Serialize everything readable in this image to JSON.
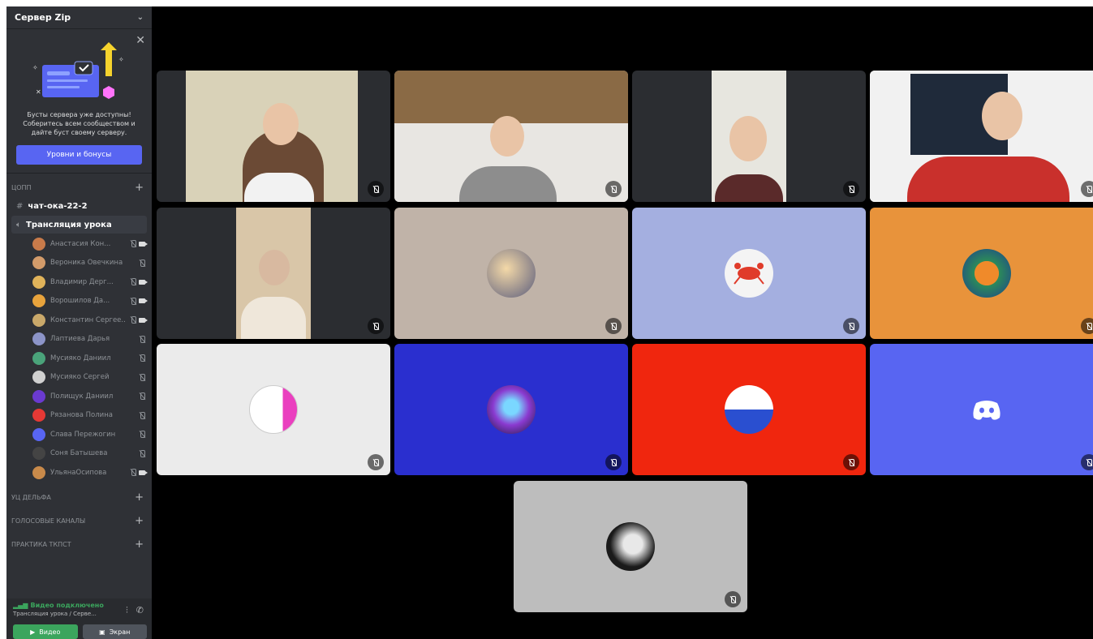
{
  "server": {
    "name": "Сервер Zip"
  },
  "boost": {
    "text": "Бусты сервера уже доступны! Соберитесь всем сообществом и дайте буст своему серверу.",
    "button": "Уровни и бонусы"
  },
  "categories": {
    "cat1": "ЦОПП",
    "cat2": "УЦ ДЕЛЬФА",
    "cat3": "ГОЛОСОВЫЕ КАНАЛЫ",
    "cat4": "ПРАКТИКА ТКПСТ"
  },
  "channels": {
    "text_channel": "чат-ока-22-2",
    "voice_channel": "Трансляция урока"
  },
  "voice_users": [
    {
      "name": "Анастасия Кон...",
      "avatar_color": "#c97b4a",
      "video": true
    },
    {
      "name": "Вероника Овечкина",
      "avatar_color": "#d39b6a",
      "video": false
    },
    {
      "name": "Владимир Дерг...",
      "avatar_color": "#e0b35a",
      "video": true
    },
    {
      "name": "Ворошилов Да...",
      "avatar_color": "#e8a33c",
      "video": true
    },
    {
      "name": "Константин Сергее...",
      "avatar_color": "#c9a86a",
      "video": true
    },
    {
      "name": "Лаптиева Дарья",
      "avatar_color": "#8c94c8",
      "video": false
    },
    {
      "name": "Мусияко Даниил",
      "avatar_color": "#4aa37a",
      "video": false
    },
    {
      "name": "Мусияко Сергей",
      "avatar_color": "#d0d0d0",
      "video": false
    },
    {
      "name": "Полищук Даниил",
      "avatar_color": "#6a3ad0",
      "video": false
    },
    {
      "name": "Рязанова Полина",
      "avatar_color": "#e53935",
      "video": false
    },
    {
      "name": "Слава Пережогин",
      "avatar_color": "#5865f2",
      "video": false
    },
    {
      "name": "Соня Батышева",
      "avatar_color": "#444444",
      "video": false
    },
    {
      "name": "УльянаОсипова",
      "avatar_color": "#c98a4a",
      "video": true
    }
  ],
  "connection": {
    "status": "Видео подключено",
    "sub": "Трансляция урока / Серве...",
    "video_button": "Видео",
    "screen_button": "Экран"
  },
  "colors": {
    "tile_beige": "#c0b3a8",
    "tile_lavender": "#a4afe0",
    "tile_orange": "#e8933b",
    "tile_white": "#ebebeb",
    "tile_blue": "#2a2fcf",
    "tile_red": "#f0260e",
    "tile_blurple": "#5865f2",
    "tile_gray": "#bdbdbd"
  }
}
